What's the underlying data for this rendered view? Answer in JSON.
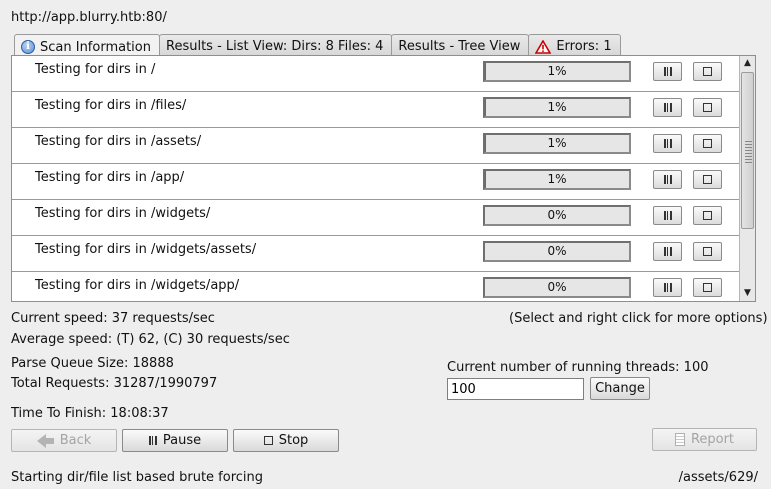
{
  "url": "http://app.blurry.htb:80/",
  "tabs": [
    {
      "label": "Scan Information",
      "icon": "info-icon"
    },
    {
      "label": "Results - List View: Dirs: 8 Files: 4"
    },
    {
      "label": "Results - Tree View"
    },
    {
      "label": "Errors: 1",
      "icon": "error-warning-icon"
    }
  ],
  "scan_rows": [
    {
      "label": "Testing for dirs in /",
      "progress": "1%"
    },
    {
      "label": "Testing for dirs in /files/",
      "progress": "1%"
    },
    {
      "label": "Testing for dirs in /assets/",
      "progress": "1%"
    },
    {
      "label": "Testing for dirs in /app/",
      "progress": "1%"
    },
    {
      "label": "Testing for dirs in /widgets/",
      "progress": "0%"
    },
    {
      "label": "Testing for dirs in /widgets/assets/",
      "progress": "0%"
    },
    {
      "label": "Testing for dirs in /widgets/app/",
      "progress": "0%"
    }
  ],
  "stats": {
    "current_speed": "Current speed: 37 requests/sec",
    "average_speed": "Average speed: (T) 62, (C) 30 requests/sec",
    "hint": "(Select and right click for more options)",
    "parse_queue": "Parse Queue Size: 18888",
    "total_requests": "Total Requests: 31287/1990797",
    "threads_label": "Current number of running threads: 100",
    "time_to_finish": "Time To Finish: 18:08:37"
  },
  "threads_input": {
    "value": "100"
  },
  "buttons": {
    "change": "Change",
    "back": "Back",
    "pause": "Pause",
    "stop": "Stop",
    "report": "Report"
  },
  "status": {
    "message": "Starting dir/file list based brute forcing",
    "current_path": "/assets/629/"
  },
  "colors": {
    "background": "#eeeeee",
    "progress_fill": "#3c6fbf",
    "error_icon": "#cc0000"
  }
}
